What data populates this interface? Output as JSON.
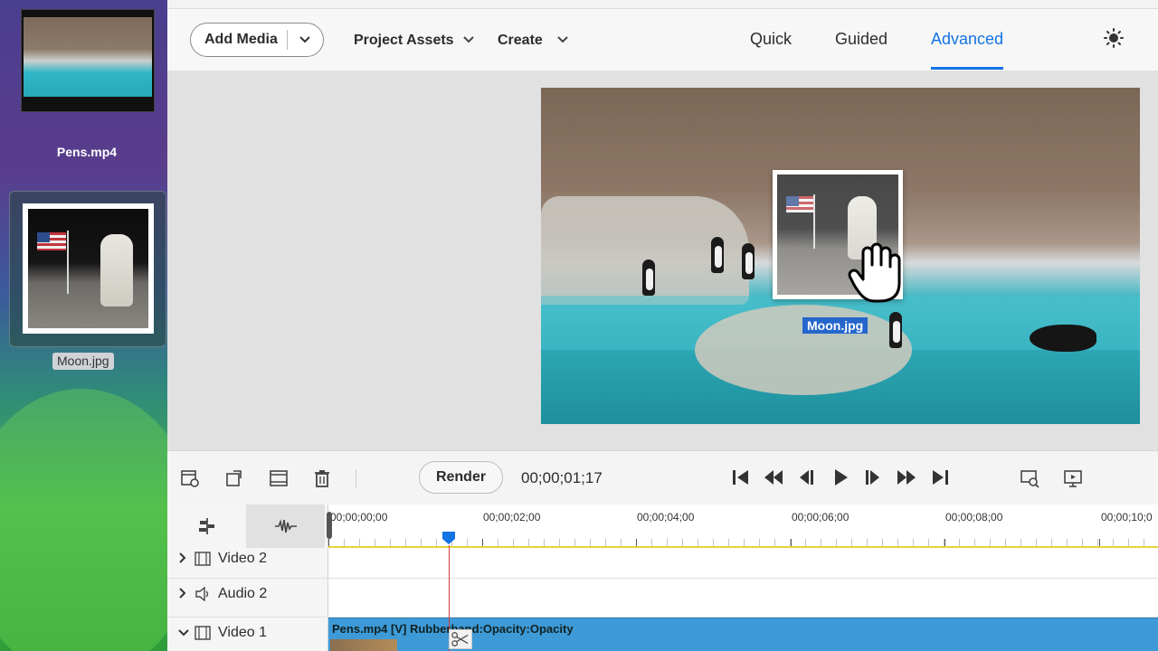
{
  "desktop": {
    "files": [
      {
        "name": "Pens.mp4"
      },
      {
        "name": "Moon.jpg",
        "selected": true
      }
    ]
  },
  "header": {
    "add_media": "Add Media",
    "project_assets": "Project Assets",
    "create": "Create",
    "modes": [
      "Quick",
      "Guided",
      "Advanced"
    ],
    "active_mode": "Advanced"
  },
  "preview": {
    "drag_label": "Moon.jpg"
  },
  "toolbar": {
    "render_label": "Render",
    "timecode": "00;00;01;17"
  },
  "timeline": {
    "ruler_labels": [
      "00;00;00;00",
      "00;00;02;00",
      "00;00;04;00",
      "00;00;06;00",
      "00;00;08;00",
      "00;00;10;0"
    ],
    "tracks": [
      {
        "name": "Video 2",
        "expanded": false
      },
      {
        "name": "Audio 2",
        "expanded": false
      },
      {
        "name": "Video 1",
        "expanded": true
      }
    ],
    "clip_label": "Pens.mp4 [V] Rubberband:Opacity:Opacity"
  },
  "colors": {
    "accent": "#1473e6",
    "clip": "#3d9ad6",
    "playhead": "#d13c3c",
    "work_area": "#e8d43b"
  }
}
